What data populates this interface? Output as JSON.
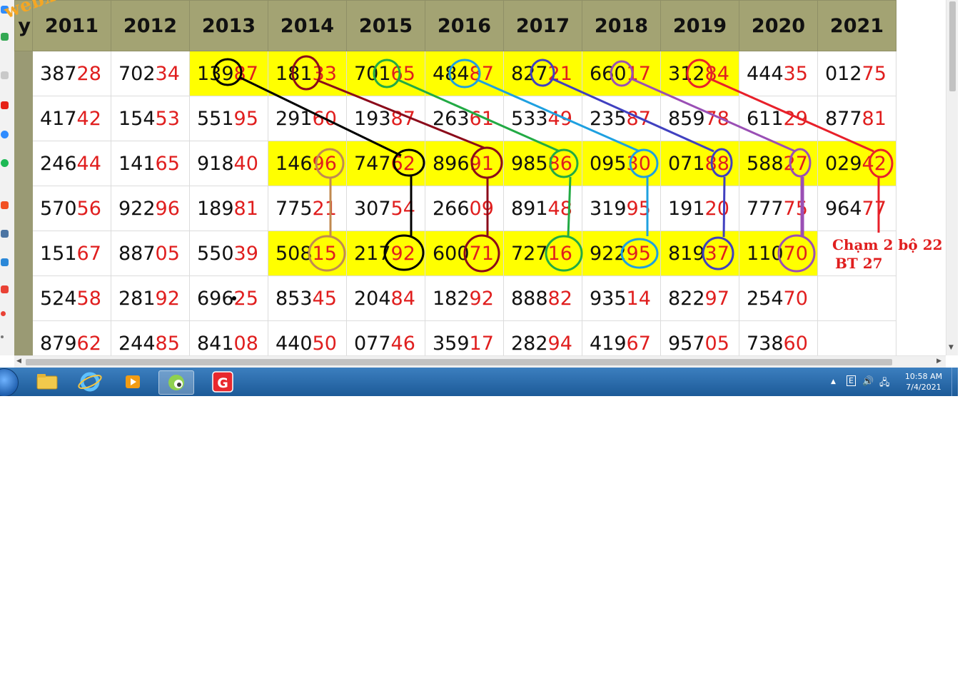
{
  "watermark": "webxoso.net",
  "table": {
    "stub_header": "y",
    "years": [
      "2011",
      "2012",
      "2013",
      "2014",
      "2015",
      "2016",
      "2017",
      "2018",
      "2019",
      "2020",
      "2021"
    ],
    "rows": [
      {
        "cells": [
          [
            "387",
            "28"
          ],
          [
            "702",
            "34"
          ],
          [
            "139",
            "87"
          ],
          [
            "181",
            "33"
          ],
          [
            "701",
            "65"
          ],
          [
            "484",
            "87"
          ],
          [
            "827",
            "21"
          ],
          [
            "660",
            "17"
          ],
          [
            "312",
            "84"
          ],
          [
            "444",
            "35"
          ],
          [
            "012",
            "75"
          ]
        ],
        "highlight": [
          false,
          false,
          true,
          true,
          true,
          true,
          true,
          true,
          true,
          false,
          false
        ]
      },
      {
        "cells": [
          [
            "417",
            "42"
          ],
          [
            "154",
            "53"
          ],
          [
            "551",
            "95"
          ],
          [
            "291",
            "60"
          ],
          [
            "193",
            "87"
          ],
          [
            "263",
            "61"
          ],
          [
            "533",
            "49"
          ],
          [
            "235",
            "87"
          ],
          [
            "859",
            "78"
          ],
          [
            "611",
            "29"
          ],
          [
            "877",
            "81"
          ]
        ],
        "highlight": [
          false,
          false,
          false,
          false,
          false,
          false,
          false,
          false,
          false,
          false,
          false
        ]
      },
      {
        "cells": [
          [
            "246",
            "44"
          ],
          [
            "141",
            "65"
          ],
          [
            "918",
            "40"
          ],
          [
            "146",
            "96"
          ],
          [
            "747",
            "62"
          ],
          [
            "896",
            "91"
          ],
          [
            "985",
            "86"
          ],
          [
            "095",
            "30"
          ],
          [
            "071",
            "88"
          ],
          [
            "588",
            "27"
          ],
          [
            "029",
            "42"
          ]
        ],
        "highlight": [
          false,
          false,
          false,
          true,
          true,
          true,
          true,
          true,
          true,
          true,
          true
        ]
      },
      {
        "cells": [
          [
            "570",
            "56"
          ],
          [
            "922",
            "96"
          ],
          [
            "189",
            "81"
          ],
          [
            "775",
            "21"
          ],
          [
            "307",
            "54"
          ],
          [
            "266",
            "09"
          ],
          [
            "891",
            "48"
          ],
          [
            "319",
            "95"
          ],
          [
            "191",
            "20"
          ],
          [
            "777",
            "75"
          ],
          [
            "964",
            "77"
          ]
        ],
        "highlight": [
          false,
          false,
          false,
          false,
          false,
          false,
          false,
          false,
          false,
          false,
          false
        ]
      },
      {
        "cells": [
          [
            "151",
            "67"
          ],
          [
            "887",
            "05"
          ],
          [
            "550",
            "39"
          ],
          [
            "508",
            "15"
          ],
          [
            "217",
            "92"
          ],
          [
            "600",
            "71"
          ],
          [
            "727",
            "16"
          ],
          [
            "922",
            "95"
          ],
          [
            "819",
            "37"
          ],
          [
            "110",
            "70"
          ],
          [
            "",
            ""
          ]
        ],
        "highlight": [
          false,
          false,
          false,
          true,
          true,
          true,
          true,
          true,
          true,
          true,
          true
        ]
      },
      {
        "cells": [
          [
            "524",
            "58"
          ],
          [
            "281",
            "92"
          ],
          [
            "696",
            "25"
          ],
          [
            "853",
            "45"
          ],
          [
            "204",
            "84"
          ],
          [
            "182",
            "92"
          ],
          [
            "888",
            "82"
          ],
          [
            "935",
            "14"
          ],
          [
            "822",
            "97"
          ],
          [
            "254",
            "70"
          ],
          [
            "",
            ""
          ]
        ],
        "highlight": [
          false,
          false,
          false,
          false,
          false,
          false,
          false,
          false,
          false,
          false,
          false
        ]
      },
      {
        "cells": [
          [
            "879",
            "62"
          ],
          [
            "244",
            "85"
          ],
          [
            "841",
            "08"
          ],
          [
            "440",
            "50"
          ],
          [
            "077",
            "46"
          ],
          [
            "359",
            "17"
          ],
          [
            "282",
            "94"
          ],
          [
            "419",
            "67"
          ],
          [
            "957",
            "05"
          ],
          [
            "738",
            "60"
          ],
          [
            "",
            ""
          ]
        ],
        "highlight": [
          false,
          false,
          false,
          false,
          false,
          false,
          false,
          false,
          false,
          false,
          false
        ]
      }
    ]
  },
  "annotation": {
    "line1": "Chạm 2 bộ 22",
    "line2": "BT 27"
  },
  "line_colors": [
    "#000000",
    "#8b0a1a",
    "#22aa44",
    "#1ea0e0",
    "#4040c0",
    "#9a4fb5",
    "#e8202a",
    "#c08a50"
  ],
  "left_strip_icons": [
    "messenger-icon",
    "chrome-icon",
    "app-icon",
    "youtube-icon",
    "messenger-icon",
    "spotify-icon",
    "office-icon",
    "vk-icon",
    "tasks-icon",
    "maps-icon",
    "pin-icon",
    "text-icon"
  ],
  "taskbar": {
    "items": [
      "windows-explorer-icon",
      "internet-explorer-icon",
      "media-player-icon",
      "coccoc-browser-icon",
      "garena-icon"
    ],
    "tray_keyboard": "E",
    "clock_time": "10:58 AM",
    "clock_date": "7/4/2021"
  }
}
